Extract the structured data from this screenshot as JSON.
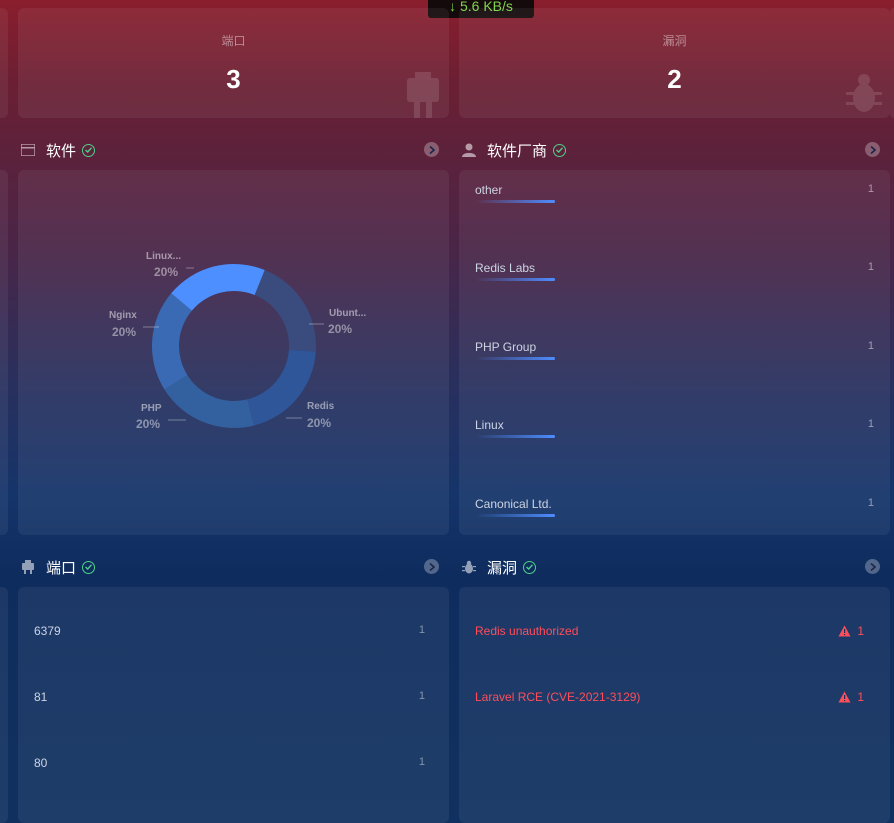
{
  "network": {
    "speed": "↓ 5.6 KB/s"
  },
  "stats": [
    {
      "label": "端口",
      "value": "3",
      "icon": "port-icon"
    },
    {
      "label": "漏洞",
      "value": "2",
      "icon": "bug-icon"
    }
  ],
  "software": {
    "title": "软件",
    "chart_data": {
      "type": "pie",
      "categories": [
        "Ubunt...",
        "Redis",
        "PHP",
        "Nginx",
        "Linux..."
      ],
      "values": [
        20,
        20,
        20,
        20,
        20
      ],
      "labels": [
        "20%",
        "20%",
        "20%",
        "20%",
        "20%"
      ],
      "colors": [
        "#3a4b7e",
        "#2f5699",
        "#33609f",
        "#3b6ab4",
        "#4d8fff"
      ]
    }
  },
  "vendors": {
    "title": "软件厂商",
    "items": [
      {
        "name": "other",
        "count": "1"
      },
      {
        "name": "Redis Labs",
        "count": "1"
      },
      {
        "name": "PHP Group",
        "count": "1"
      },
      {
        "name": "Linux",
        "count": "1"
      },
      {
        "name": "Canonical Ltd.",
        "count": "1"
      }
    ]
  },
  "ports": {
    "title": "端口",
    "items": [
      {
        "port": "6379",
        "count": "1"
      },
      {
        "port": "81",
        "count": "1"
      },
      {
        "port": "80",
        "count": "1"
      }
    ]
  },
  "vulns": {
    "title": "漏洞",
    "items": [
      {
        "name": "Redis unauthorized",
        "count": "1"
      },
      {
        "name": "Laravel RCE (CVE-2021-3129)",
        "count": "1"
      }
    ]
  }
}
